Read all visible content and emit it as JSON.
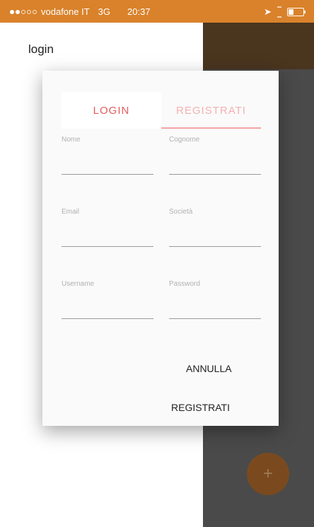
{
  "status_bar": {
    "carrier": "vodafone IT",
    "network": "3G",
    "time": "20:37",
    "background": "#d9822b"
  },
  "header": {
    "title": "login"
  },
  "dialog": {
    "tabs": [
      {
        "label": "LOGIN"
      },
      {
        "label": "REGISTRATI",
        "active": true
      }
    ],
    "fields": {
      "nome": {
        "label": "Nome",
        "value": ""
      },
      "cognome": {
        "label": "Cognome",
        "value": ""
      },
      "email": {
        "label": "Email",
        "value": ""
      },
      "societa": {
        "label": "Società",
        "value": ""
      },
      "username": {
        "label": "Username",
        "value": ""
      },
      "password": {
        "label": "Password",
        "value": ""
      }
    },
    "buttons": {
      "cancel": "ANNULLA",
      "register": "REGISTRATI"
    },
    "accent_color": "#e45c5c"
  },
  "fab": {
    "icon": "plus-icon",
    "label": "+"
  }
}
